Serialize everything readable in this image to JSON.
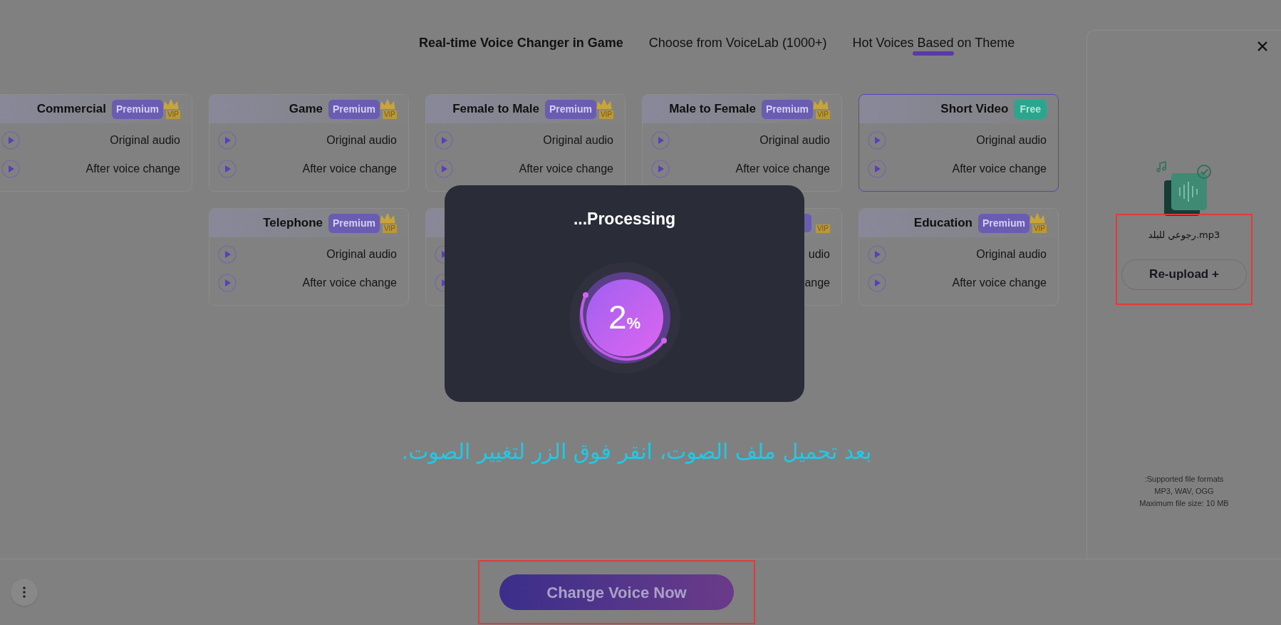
{
  "tabs": [
    {
      "label": "Real-time Voice Changer in Game",
      "selected": false,
      "emphasized": true
    },
    {
      "label": "Choose from VoiceLab (1000+)",
      "selected": false,
      "emphasized": false
    },
    {
      "label": "Hot Voices Based on Theme",
      "selected": true,
      "emphasized": false
    }
  ],
  "card_rows": [
    [
      {
        "title": "Commercial",
        "selected": false,
        "badge": {
          "kind": "premium",
          "label": "Premium",
          "tag": "VIP"
        },
        "options": [
          {
            "kind": "play",
            "label": "Original audio"
          },
          {
            "kind": "play",
            "label": "After voice change"
          }
        ]
      },
      {
        "title": "Game",
        "selected": false,
        "badge": {
          "kind": "premium",
          "label": "Premium",
          "tag": "VIP"
        },
        "options": [
          {
            "kind": "play",
            "label": "Original audio"
          },
          {
            "kind": "play",
            "label": "After voice change"
          }
        ]
      },
      {
        "title": "Female to Male",
        "selected": false,
        "badge": {
          "kind": "premium",
          "label": "Premium",
          "tag": "VIP"
        },
        "options": [
          {
            "kind": "play",
            "label": "Original audio"
          },
          {
            "kind": "play",
            "label": "After voice change"
          }
        ]
      },
      {
        "title": "Male to Female",
        "selected": false,
        "badge": {
          "kind": "premium",
          "label": "Premium",
          "tag": "VIP"
        },
        "options": [
          {
            "kind": "play",
            "label": "Original audio"
          },
          {
            "kind": "play",
            "label": "After voice change"
          }
        ]
      },
      {
        "title": "Short Video",
        "selected": true,
        "badge": {
          "kind": "free",
          "label": "Free"
        },
        "options": [
          {
            "kind": "play",
            "label": "Original audio"
          },
          {
            "kind": "play",
            "label": "After voice change"
          }
        ]
      }
    ],
    [
      {
        "title": "Telephone",
        "selected": false,
        "badge": {
          "kind": "premium",
          "label": "Premium",
          "tag": "VIP"
        },
        "options": [
          {
            "kind": "play",
            "label": "Original audio"
          },
          {
            "kind": "play",
            "label": "After voice change"
          }
        ]
      },
      {
        "selected": false,
        "options": [
          {
            "kind": "play"
          },
          {
            "kind": "play"
          }
        ]
      },
      {
        "selected": false,
        "badge": {
          "kind": "premium",
          "tag": "VIP"
        },
        "options": [
          {
            "kind": "text",
            "label": "udio"
          },
          {
            "kind": "text",
            "label": "ange"
          }
        ]
      },
      {
        "title": "Education",
        "selected": false,
        "badge": {
          "kind": "premium",
          "label": "Premium",
          "tag": "VIP"
        },
        "options": [
          {
            "kind": "play",
            "label": "Original audio"
          },
          {
            "kind": "play",
            "label": "After voice change"
          }
        ]
      }
    ]
  ],
  "caption": "بعد تحميل ملف الصوت، انقر فوق الزر لتغيير الصوت.",
  "modal": {
    "title": "...Processing",
    "percent": "2",
    "unit": "%"
  },
  "upload_panel": {
    "file_name": "رجوعي للبلد.mp3",
    "reupload_button": "Re-upload +",
    "highlighted": true,
    "formats_lines": [
      ":Supported file formats",
      "MP3, WAV, OGG",
      "Maximum file size: 10 MB"
    ]
  },
  "bottom_bar": {
    "action_button": "Change Voice Now",
    "highlighted": true
  }
}
